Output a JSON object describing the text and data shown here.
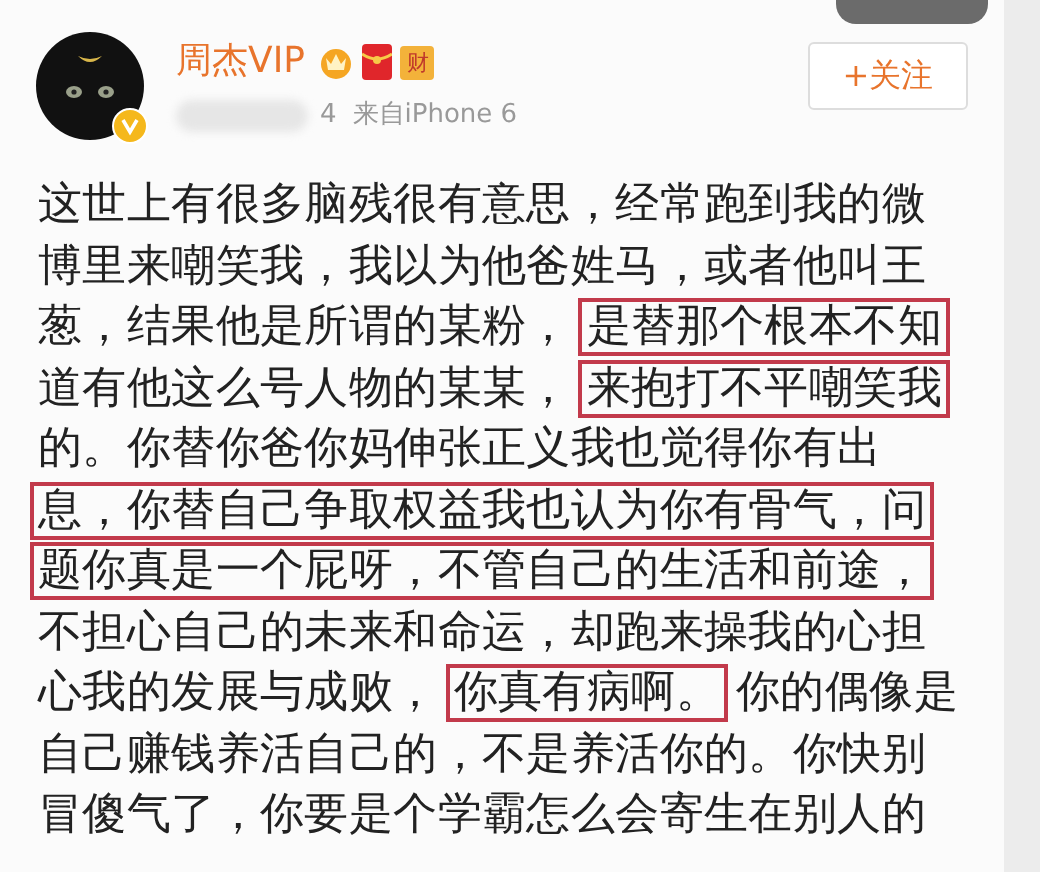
{
  "author": {
    "name": "周杰VIP",
    "verified": true,
    "badges": [
      {
        "kind": "crown"
      },
      {
        "kind": "envelope"
      },
      {
        "kind": "text",
        "text": "财"
      }
    ]
  },
  "meta": {
    "time": "4",
    "source": "来自iPhone 6"
  },
  "follow_button": "+关注",
  "post": {
    "lines": [
      [
        {
          "text": "这世上有很多脑残很有意思，经常跑到我的微",
          "highlighted": false
        }
      ],
      [
        {
          "text": "博里来嘲笑我，我以为他爸姓马，或者他叫王",
          "highlighted": false
        }
      ],
      [
        {
          "text": "葱，结果他是所谓的某粉，",
          "highlighted": false
        },
        {
          "text": "是替那个根本不知",
          "highlighted": true
        }
      ],
      [
        {
          "text": "道有他这么号人物的某某，",
          "highlighted": false
        },
        {
          "text": "来抱打不平嘲笑我",
          "highlighted": true
        }
      ],
      [
        {
          "text": "的。你替你爸你妈伸张正义我也觉得你有出",
          "highlighted": false
        }
      ],
      [
        {
          "text": "息，你替自己争取权益我也认为你有骨气，问",
          "highlighted": true
        }
      ],
      [
        {
          "text": "题你真是一个屁呀，不管自己的生活和前途，",
          "highlighted": true
        }
      ],
      [
        {
          "text": "不担心自己的未来和命运，却跑来操我的心担",
          "highlighted": false
        }
      ],
      [
        {
          "text": "心我的发展与成败，",
          "highlighted": false
        },
        {
          "text": "你真有病啊。",
          "highlighted": true
        },
        {
          "text": "你的偶像是",
          "highlighted": false
        }
      ],
      [
        {
          "text": "自己赚钱养活自己的，不是养活你的。你快别",
          "highlighted": false
        }
      ],
      [
        {
          "text": "冒傻气了，你要是个学霸怎么会寄生在别人的",
          "highlighted": false
        }
      ]
    ]
  }
}
